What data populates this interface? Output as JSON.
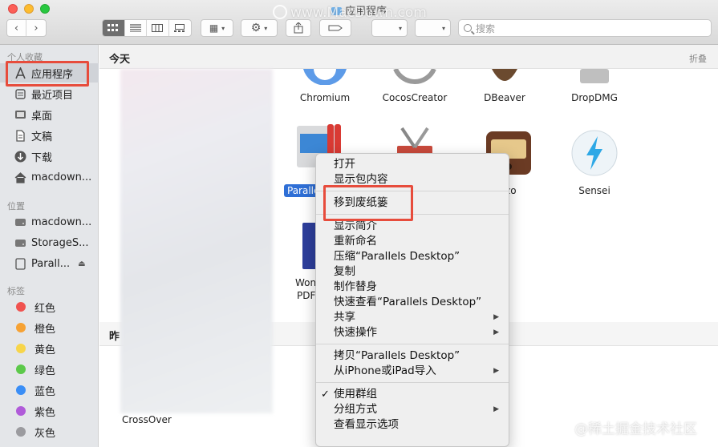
{
  "window": {
    "title": "应用程序"
  },
  "search": {
    "placeholder": "搜索"
  },
  "sidebar": {
    "sections": {
      "favorites": "个人收藏",
      "locations": "位置",
      "tags": "标签"
    },
    "favorites": [
      {
        "label": "应用程序",
        "icon": "applications-icon"
      },
      {
        "label": "最近项目",
        "icon": "recents-icon"
      },
      {
        "label": "桌面",
        "icon": "desktop-icon"
      },
      {
        "label": "文稿",
        "icon": "documents-icon"
      },
      {
        "label": "下载",
        "icon": "downloads-icon"
      },
      {
        "label": "macdown...",
        "icon": "home-icon"
      }
    ],
    "locations": [
      {
        "label": "macdown...",
        "icon": "disk-icon"
      },
      {
        "label": "StorageS...",
        "icon": "disk-icon"
      },
      {
        "label": "Parall...",
        "icon": "disk-icon"
      }
    ],
    "tags": [
      {
        "label": "红色",
        "color": "#f0524f"
      },
      {
        "label": "橙色",
        "color": "#f6a234"
      },
      {
        "label": "黄色",
        "color": "#f7d54a"
      },
      {
        "label": "绿色",
        "color": "#5cc94a"
      },
      {
        "label": "蓝色",
        "color": "#3a8ef6"
      },
      {
        "label": "紫色",
        "color": "#b05bd9"
      },
      {
        "label": "灰色",
        "color": "#9b9b9f"
      }
    ]
  },
  "main": {
    "section_today": "今天",
    "collapse": "折叠",
    "section_yesterday": "昨",
    "apps_row1": [
      "Chromium",
      "CocosCreator",
      "DBeaver",
      "DropDMG"
    ],
    "apps_row2_visible": [
      "Paralle",
      "zo",
      "Sensei"
    ],
    "apps_row3_partial": [
      "Wond",
      "PDF"
    ],
    "crossover": "CrossOver"
  },
  "context_menu": {
    "items": [
      {
        "label": "打开"
      },
      {
        "label": "显示包内容"
      },
      {
        "sep": true
      },
      {
        "label": "移到废纸篓"
      },
      {
        "sep": true
      },
      {
        "label": "显示简介"
      },
      {
        "label": "重新命名"
      },
      {
        "label": "压缩“Parallels Desktop”"
      },
      {
        "label": "复制"
      },
      {
        "label": "制作替身"
      },
      {
        "label": "快速查看“Parallels Desktop”"
      },
      {
        "label": "共享",
        "submenu": true
      },
      {
        "label": "快速操作",
        "submenu": true
      },
      {
        "sep": true
      },
      {
        "label": "拷贝“Parallels Desktop”"
      },
      {
        "label": "从iPhone或iPad导入",
        "submenu": true
      },
      {
        "sep": true
      },
      {
        "label": "使用群组",
        "checked": true
      },
      {
        "label": "分组方式",
        "submenu": true
      },
      {
        "label": "查看显示选项"
      }
    ]
  },
  "watermarks": {
    "top": "www.MacDown.com",
    "bottom": "@稀土掘金技术社区"
  }
}
